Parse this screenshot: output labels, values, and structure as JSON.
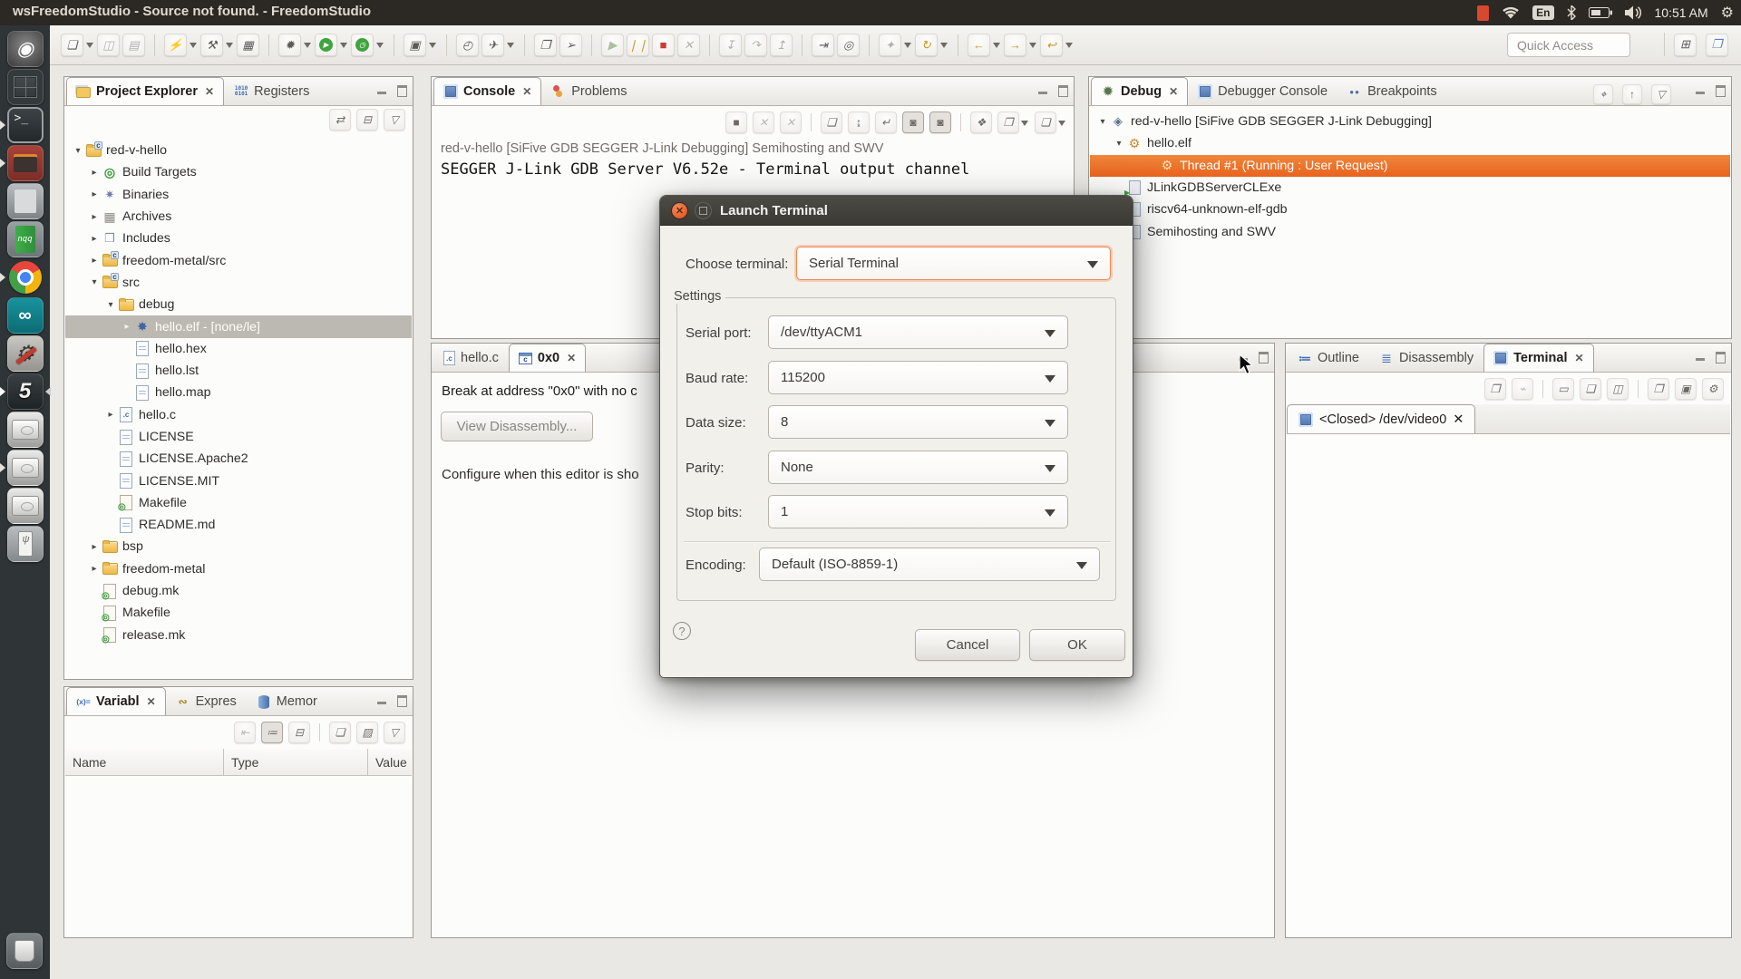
{
  "system_bar": {
    "title": "wsFreedomStudio - Source not found. - FreedomStudio",
    "time": "10:51 AM",
    "keyboard_indicator": "En",
    "icons": [
      "recording-indicator",
      "wifi-icon",
      "keyboard-layout",
      "bluetooth-icon",
      "battery-icon",
      "volume-icon",
      "clock",
      "session-gear-icon"
    ]
  },
  "launcher": {
    "items": [
      {
        "name": "dash-home-button",
        "cls": "li li-dash",
        "label": "◉"
      },
      {
        "name": "workspace-switcher-button",
        "cls": "li li-ws",
        "label": ""
      },
      {
        "name": "terminal-app-button",
        "cls": "li li-term run",
        "label": ">_"
      },
      {
        "name": "archive-app-button",
        "cls": "li li-mail run",
        "label": ""
      },
      {
        "name": "calculator-app-button",
        "cls": "li li-calc",
        "label": ""
      },
      {
        "name": "notepadqq-app-button",
        "cls": "li li-nqq",
        "label": "nqq"
      },
      {
        "name": "chrome-app-button",
        "cls": "li li-chrome run",
        "label": ""
      },
      {
        "name": "arduino-app-button",
        "cls": "li li-arduino",
        "label": "∞"
      },
      {
        "name": "build-tools-app-button",
        "cls": "li li-tools",
        "label": "⚙"
      },
      {
        "name": "freedomstudio-app-button",
        "cls": "li li-fs active",
        "label": "5"
      },
      {
        "name": "disk-drive-1-button",
        "cls": "li li-disk",
        "label": ""
      },
      {
        "name": "disk-drive-2-button",
        "cls": "li li-disk run",
        "label": ""
      },
      {
        "name": "disk-drive-3-button",
        "cls": "li li-disk",
        "label": ""
      },
      {
        "name": "usb-drive-button",
        "cls": "li li-usb",
        "label": ""
      }
    ],
    "trash": "trash-button"
  },
  "toolbar": {
    "quick_access": "Quick Access",
    "buttons": [
      {
        "name": "new-button",
        "cls": "tbtn dd",
        "g": "❏"
      },
      {
        "name": "save-button",
        "cls": "tbtn dis",
        "g": "◫"
      },
      {
        "name": "save-all-button",
        "cls": "tbtn dis",
        "g": "▤"
      },
      {
        "name": "sep",
        "cls": "tsep",
        "g": ""
      },
      {
        "name": "flash-target-button",
        "cls": "tbtn dd",
        "g": "⚡"
      },
      {
        "name": "build-button",
        "cls": "tbtn dd",
        "g": "⚒"
      },
      {
        "name": "build-log-button",
        "cls": "tbtn",
        "g": "▦"
      },
      {
        "name": "sep",
        "cls": "tsep",
        "g": ""
      },
      {
        "name": "debug-button",
        "cls": "tbtn dd",
        "g": "✹"
      },
      {
        "name": "run-button",
        "cls": "tbtn dd circ",
        "g": "▶"
      },
      {
        "name": "profile-button",
        "cls": "tbtn dd circ",
        "g": "◷"
      },
      {
        "name": "sep",
        "cls": "tsep",
        "g": ""
      },
      {
        "name": "open-element-button",
        "cls": "tbtn dd",
        "g": "▣"
      },
      {
        "name": "sep",
        "cls": "tsep",
        "g": ""
      },
      {
        "name": "history-button",
        "cls": "tbtn",
        "g": "◴"
      },
      {
        "name": "external-tools-button",
        "cls": "tbtn dd",
        "g": "✈"
      },
      {
        "name": "sep",
        "cls": "tsep",
        "g": ""
      },
      {
        "name": "open-console-button",
        "cls": "tbtn",
        "g": "❐"
      },
      {
        "name": "select-pointer-button",
        "cls": "tbtn",
        "g": "➢"
      },
      {
        "name": "sep",
        "cls": "tsep",
        "g": ""
      },
      {
        "name": "resume-button",
        "cls": "tbtn dis2 c-green",
        "g": "▶"
      },
      {
        "name": "suspend-button",
        "cls": "tbtn c-amb",
        "g": "❘❘"
      },
      {
        "name": "terminate-button",
        "cls": "tbtn c-red",
        "g": "■"
      },
      {
        "name": "disconnect-button",
        "cls": "tbtn dis",
        "g": "✕"
      },
      {
        "name": "sep",
        "cls": "tsep",
        "g": ""
      },
      {
        "name": "step-into-button",
        "cls": "tbtn dis",
        "g": "↧"
      },
      {
        "name": "step-over-button",
        "cls": "tbtn dis",
        "g": "↷"
      },
      {
        "name": "step-return-button",
        "cls": "tbtn dis",
        "g": "↥"
      },
      {
        "name": "sep",
        "cls": "tsep",
        "g": ""
      },
      {
        "name": "instruction-stepping-button",
        "cls": "tbtn",
        "g": "⇥"
      },
      {
        "name": "trace-button",
        "cls": "tbtn",
        "g": "◎"
      },
      {
        "name": "sep",
        "cls": "tsep",
        "g": ""
      },
      {
        "name": "new-launch-button",
        "cls": "tbtn dd dis",
        "g": "✦"
      },
      {
        "name": "restart-button",
        "cls": "tbtn dd c-amb",
        "g": "↻"
      },
      {
        "name": "sep",
        "cls": "tsep",
        "g": ""
      },
      {
        "name": "back-button",
        "cls": "tbtn dd c-amb",
        "g": "←"
      },
      {
        "name": "forward-button",
        "cls": "tbtn dd c-amb",
        "g": "→"
      },
      {
        "name": "last-edit-button",
        "cls": "tbtn dd c-amb",
        "g": "↩"
      }
    ],
    "right_buttons": [
      {
        "name": "open-perspective-button",
        "cls": "tbtn",
        "g": "⊞"
      },
      {
        "name": "debug-perspective-button",
        "cls": "tbtn",
        "g": "❒"
      }
    ]
  },
  "project_explorer": {
    "tabs": [
      "Project Explorer",
      "Registers"
    ],
    "registers_icon_lines": [
      "1010",
      "0101"
    ],
    "view_toolbar": [
      {
        "name": "link-with-editor-button",
        "cls": "cbtn",
        "g": "⇄"
      },
      {
        "name": "collapse-all-button",
        "cls": "cbtn",
        "g": "⊟"
      },
      {
        "name": "view-menu-button",
        "cls": "cbtn",
        "g": "▽"
      }
    ],
    "tree": [
      {
        "label": "red-v-hello",
        "cls": "trow d0",
        "icon": "ic fold cbadge",
        "exp": "▾",
        "badge": "c"
      },
      {
        "label": "Build Targets",
        "cls": "trow d1",
        "icon": "ic target",
        "exp": "▸",
        "glyph": "◎"
      },
      {
        "label": "Binaries",
        "cls": "trow d1",
        "icon": "ic bin",
        "exp": "▸",
        "glyph": "✷"
      },
      {
        "label": "Archives",
        "cls": "trow d1",
        "icon": "ic arch",
        "exp": "▸",
        "glyph": "▦"
      },
      {
        "label": "Includes",
        "cls": "trow d1",
        "icon": "ic inc",
        "exp": "▸",
        "glyph": "❒"
      },
      {
        "label": "freedom-metal/src",
        "cls": "trow d1",
        "icon": "ic fold cbadge",
        "exp": "▸",
        "badge": "c"
      },
      {
        "label": "src",
        "cls": "trow d1",
        "icon": "ic fold cbadge",
        "exp": "▾",
        "badge": "c"
      },
      {
        "label": "debug",
        "cls": "trow d2",
        "icon": "ic fold",
        "exp": "▾"
      },
      {
        "label": "hello.elf - [none/le]",
        "cls": "trow d3 sel",
        "icon": "ic elf",
        "exp": "▸",
        "glyph": "✸"
      },
      {
        "label": "hello.hex",
        "cls": "trow d3",
        "icon": "ic file",
        "exp": ""
      },
      {
        "label": "hello.lst",
        "cls": "trow d3",
        "icon": "ic file",
        "exp": ""
      },
      {
        "label": "hello.map",
        "cls": "trow d3",
        "icon": "ic file",
        "exp": ""
      },
      {
        "label": "hello.c",
        "cls": "trow d2",
        "icon": "ic cfileic",
        "exp": "▸"
      },
      {
        "label": "LICENSE",
        "cls": "trow d2",
        "icon": "ic file",
        "exp": ""
      },
      {
        "label": "LICENSE.Apache2",
        "cls": "trow d2",
        "icon": "ic file",
        "exp": ""
      },
      {
        "label": "LICENSE.MIT",
        "cls": "trow d2",
        "icon": "ic file",
        "exp": ""
      },
      {
        "label": "Makefile",
        "cls": "trow d2",
        "icon": "ic make",
        "exp": ""
      },
      {
        "label": "README.md",
        "cls": "trow d2",
        "icon": "ic file",
        "exp": ""
      },
      {
        "label": "bsp",
        "cls": "trow d1",
        "icon": "ic fold",
        "exp": "▸"
      },
      {
        "label": "freedom-metal",
        "cls": "trow d1",
        "icon": "ic fold",
        "exp": "▸"
      },
      {
        "label": "debug.mk",
        "cls": "trow d1",
        "icon": "ic make",
        "exp": ""
      },
      {
        "label": "Makefile",
        "cls": "trow d1",
        "icon": "ic make",
        "exp": ""
      },
      {
        "label": "release.mk",
        "cls": "trow d1",
        "icon": "ic make",
        "exp": ""
      }
    ]
  },
  "variables": {
    "tabs": [
      "Variabl",
      "Expres",
      "Memor"
    ],
    "variables_icon": "(x)=",
    "columns": [
      "Name",
      "Type",
      "Value"
    ],
    "view_toolbar": [
      {
        "name": "show-logical-structure-button",
        "cls": "cbtn dis",
        "g": "⇤"
      },
      {
        "name": "show-type-names-button",
        "cls": "cbtn press",
        "g": "≔"
      },
      {
        "name": "collapse-all-button",
        "cls": "cbtn",
        "g": "⊟"
      },
      {
        "name": "sep",
        "cls": "csep",
        "g": ""
      },
      {
        "name": "new-watch-button",
        "cls": "cbtn",
        "g": "❏"
      },
      {
        "name": "edit-watch-button",
        "cls": "cbtn",
        "g": "▨"
      },
      {
        "name": "view-menu-button",
        "cls": "cbtn",
        "g": "▽"
      }
    ]
  },
  "console": {
    "tabs": [
      "Console",
      "Problems"
    ],
    "launch_label": "red-v-hello [SiFive GDB SEGGER J-Link Debugging] Semihosting and SWV",
    "output": "SEGGER J-Link GDB Server V6.52e - Terminal output channel",
    "view_toolbar": [
      {
        "name": "terminate-button",
        "cls": "cbtn c-red",
        "g": "■"
      },
      {
        "name": "remove-launch-button",
        "cls": "cbtn dis",
        "g": "✕"
      },
      {
        "name": "remove-all-launches-button",
        "cls": "cbtn dis",
        "g": "✕"
      },
      {
        "name": "sep",
        "cls": "csep",
        "g": ""
      },
      {
        "name": "clear-console-button",
        "cls": "cbtn",
        "g": "❑"
      },
      {
        "name": "scroll-lock-button",
        "cls": "cbtn",
        "g": "↨"
      },
      {
        "name": "word-wrap-button",
        "cls": "cbtn",
        "g": "↵"
      },
      {
        "name": "pin-console-button",
        "cls": "cbtn press",
        "g": "◙"
      },
      {
        "name": "show-stdout-button",
        "cls": "cbtn press",
        "g": "◙"
      },
      {
        "name": "sep",
        "cls": "csep",
        "g": ""
      },
      {
        "name": "display-selected-console-button",
        "cls": "cbtn c-green",
        "g": "❖"
      },
      {
        "name": "open-console-button",
        "cls": "cbtn dd c-nav",
        "g": "❒"
      },
      {
        "name": "new-console-view-button",
        "cls": "cbtn dd",
        "g": "❏"
      }
    ]
  },
  "debug_view": {
    "tabs": [
      "Debug",
      "Debugger Console",
      "Breakpoints"
    ],
    "view_toolbar": [
      {
        "name": "remove-terminated-button",
        "cls": "cbtn",
        "g": "⌖"
      },
      {
        "name": "restart-button",
        "cls": "cbtn c-amb",
        "g": "↑"
      },
      {
        "name": "view-menu-button",
        "cls": "cbtn",
        "g": "▽"
      }
    ],
    "tree": [
      {
        "label": "red-v-hello [SiFive GDB SEGGER J-Link Debugging]",
        "cls": "trow drow d0",
        "icon": "ic launch",
        "exp": "▾",
        "glyph": "◈"
      },
      {
        "label": "hello.elf",
        "cls": "trow drow d1",
        "icon": "ic gears",
        "exp": "▾",
        "glyph": "⚙"
      },
      {
        "label": "Thread #1 (Running : User Request)",
        "cls": "trow drow d2 sel",
        "icon": "ic thr",
        "exp": "",
        "glyph": "⚙"
      },
      {
        "label": "JLinkGDBServerCLExe",
        "cls": "trow drow d1",
        "icon": "ic proc",
        "exp": ""
      },
      {
        "label": "riscv64-unknown-elf-gdb",
        "cls": "trow drow d1",
        "icon": "ic proc",
        "exp": ""
      },
      {
        "label": "Semihosting and SWV",
        "cls": "trow drow d1",
        "icon": "ic proc",
        "exp": ""
      }
    ]
  },
  "editor": {
    "tabs": [
      {
        "label": "hello.c",
        "active": false
      },
      {
        "label": "0x0",
        "active": true
      }
    ],
    "message": "Break at address \"0x0\" with no c",
    "view_disassembly_label": "View Disassembly...",
    "configure_note": "Configure when this editor is sho"
  },
  "terminal_panel": {
    "tabs": [
      "Outline",
      "Disassembly",
      "Terminal"
    ],
    "inner_tab": "<Closed> /dev/video0",
    "view_toolbar": [
      {
        "name": "new-terminal-button",
        "cls": "cbtn c-nav",
        "g": "❒"
      },
      {
        "name": "disconnect-terminal-button",
        "cls": "cbtn dis",
        "g": "⌁"
      },
      {
        "name": "sep",
        "cls": "csep",
        "g": ""
      },
      {
        "name": "show-command-input-button",
        "cls": "cbtn",
        "g": "▭"
      },
      {
        "name": "clear-terminal-button",
        "cls": "cbtn",
        "g": "❑"
      },
      {
        "name": "scroll-lock-button",
        "cls": "cbtn",
        "g": "◫"
      },
      {
        "name": "sep",
        "cls": "csep",
        "g": ""
      },
      {
        "name": "copy-button",
        "cls": "cbtn",
        "g": "❐"
      },
      {
        "name": "paste-button",
        "cls": "cbtn",
        "g": "▣"
      },
      {
        "name": "settings-button",
        "cls": "cbtn",
        "g": "⚙"
      }
    ]
  },
  "dialog": {
    "title": "Launch Terminal",
    "choose_terminal_label": "Choose terminal:",
    "choose_terminal_value": "Serial Terminal",
    "settings_label": "Settings",
    "fields": [
      {
        "label": "Serial port:",
        "value": "/dev/ttyACM1"
      },
      {
        "label": "Baud rate:",
        "value": "115200"
      },
      {
        "label": "Data size:",
        "value": "8"
      },
      {
        "label": "Parity:",
        "value": "None"
      },
      {
        "label": "Stop bits:",
        "value": "1"
      }
    ],
    "encoding_label": "Encoding:",
    "encoding_value": "Default (ISO-8859-1)",
    "help_label": "?",
    "cancel_label": "Cancel",
    "ok_label": "OK"
  },
  "colors": {
    "selection_orange": "#e8631e",
    "focus_ring_orange": "#f0854c",
    "ubuntu_bar": "#2c2824",
    "dialog_title_bar": "#3b3934"
  },
  "window_controls": [
    "minimize",
    "maximize"
  ]
}
